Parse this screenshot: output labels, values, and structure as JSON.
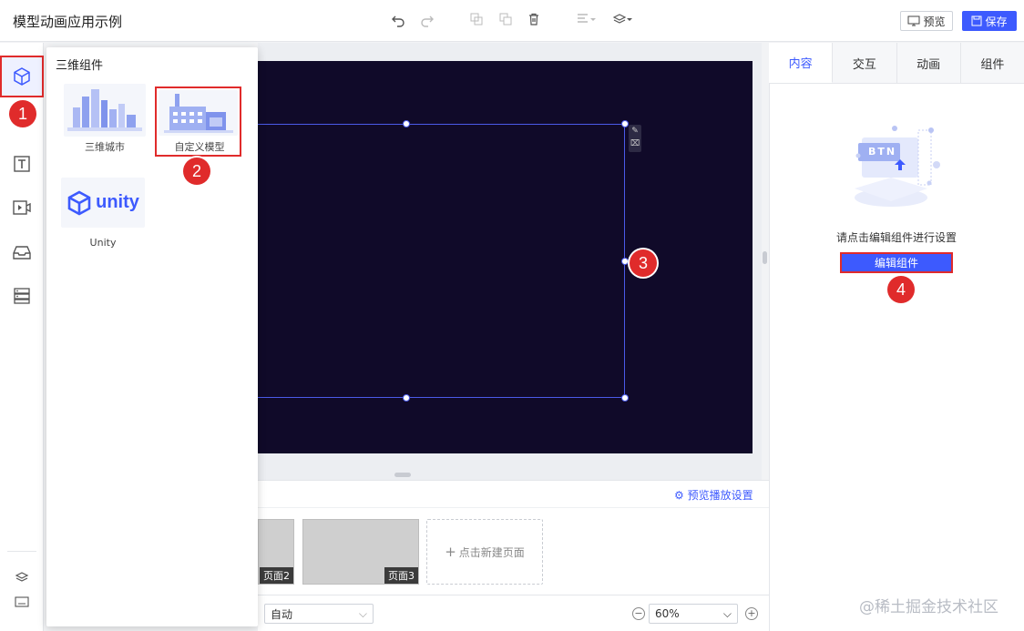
{
  "app": {
    "title": "模型动画应用示例"
  },
  "toolbar": {
    "icons": [
      "undo-icon",
      "redo-icon",
      "copy-icon",
      "paste-icon",
      "delete-icon",
      "align-icon",
      "layers-icon"
    ],
    "preview_label": "预览",
    "save_label": "保存"
  },
  "rail": {
    "items": [
      "3d-cube-icon",
      "text-icon",
      "video-icon",
      "inbox-icon",
      "server-icon"
    ],
    "bottom": [
      "layers-icon",
      "keyboard-icon"
    ]
  },
  "flyout": {
    "title": "三维组件",
    "components": [
      {
        "label": "三维城市",
        "icon": "city-icon"
      },
      {
        "label": "自定义模型",
        "icon": "factory-icon"
      },
      {
        "label": "Unity",
        "icon": "unity-icon",
        "logo_text": "unity"
      }
    ]
  },
  "pages": {
    "play_settings": "预览播放设置",
    "thumbs": [
      {
        "label": "页面2"
      },
      {
        "label": "页面3"
      }
    ],
    "new_page": "点击新建页面"
  },
  "bottombar": {
    "fit_mode": "自动",
    "zoom": "60%"
  },
  "panel": {
    "tabs": [
      "内容",
      "交互",
      "动画",
      "组件"
    ],
    "illustration_text": "BTN",
    "hint": "请点击编辑组件进行设置",
    "edit_button": "编辑组件"
  },
  "annotations": [
    "1",
    "2",
    "3",
    "4"
  ],
  "watermark": "@稀土掘金技术社区",
  "colors": {
    "accent": "#3d5afe",
    "canvas": "#100a29",
    "annotation": "#e02b2b"
  }
}
